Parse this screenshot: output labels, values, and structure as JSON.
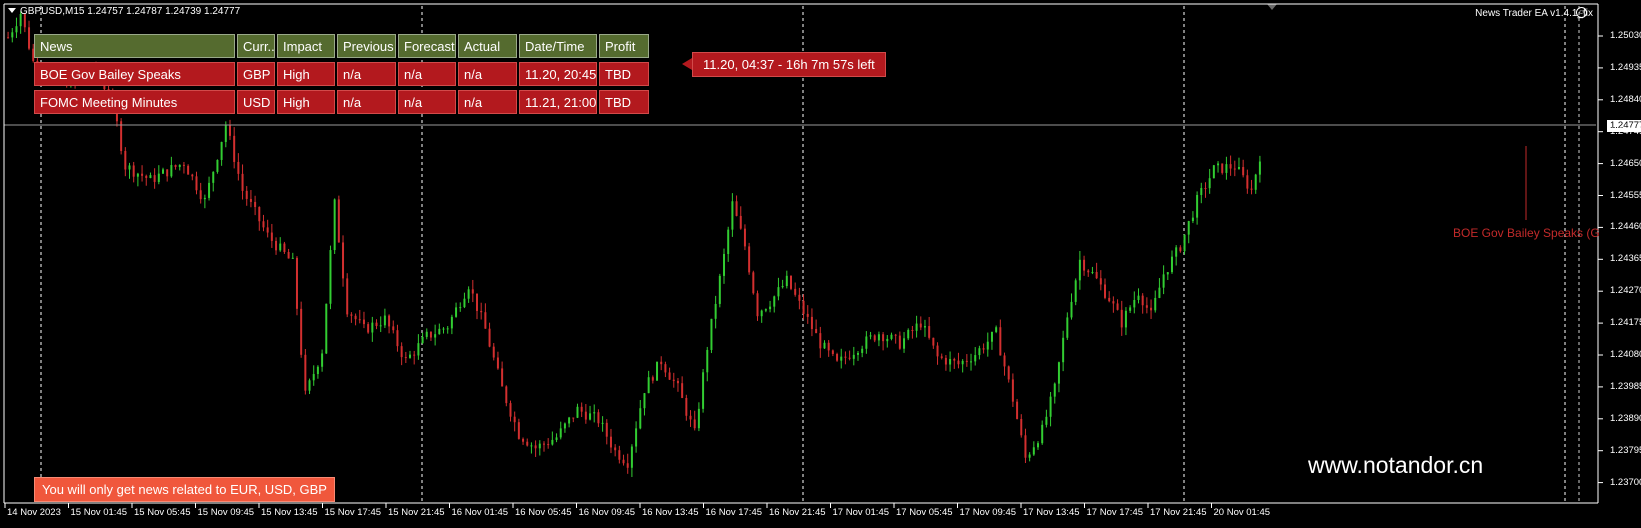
{
  "header": {
    "symbol_info": "GBPUSD,M15  1.24757 1.24787 1.24739 1.24777",
    "ea_name": "News Trader EA  v1.4.1_fix",
    "smile_icon": "smiley-icon"
  },
  "news_table": {
    "columns": [
      "News",
      "Curr..",
      "Impact",
      "Previous",
      "Forecast",
      "Actual",
      "Date/Time",
      "Profit"
    ],
    "rows": [
      [
        "BOE Gov Bailey Speaks",
        "GBP",
        "High",
        "n/a",
        "n/a",
        "n/a",
        "11.20, 20:45",
        "TBD"
      ],
      [
        "FOMC Meeting Minutes",
        "USD",
        "High",
        "n/a",
        "n/a",
        "n/a",
        "11.21, 21:00",
        "TBD"
      ]
    ]
  },
  "countdown": "11.20, 04:37 - 16h 7m 57s left",
  "filter_note": "You will only get news related to EUR, USD, GBP",
  "watermark": "www.notandor.cn",
  "event_marker_label": "BOE Gov Bailey Speaks (G",
  "price_axis": {
    "labels": [
      "1.25030",
      "1.24935",
      "1.24840",
      "1.24745",
      "1.24650",
      "1.24555",
      "1.24460",
      "1.24365",
      "1.24270",
      "1.24175",
      "1.24080",
      "1.23985",
      "1.23890",
      "1.23795",
      "1.23700"
    ],
    "current_price": "1.24777"
  },
  "time_axis": {
    "labels": [
      "14 Nov 2023",
      "15 Nov 01:45",
      "15 Nov 05:45",
      "15 Nov 09:45",
      "15 Nov 13:45",
      "15 Nov 17:45",
      "15 Nov 21:45",
      "16 Nov 01:45",
      "16 Nov 05:45",
      "16 Nov 09:45",
      "16 Nov 13:45",
      "16 Nov 17:45",
      "16 Nov 21:45",
      "17 Nov 01:45",
      "17 Nov 05:45",
      "17 Nov 09:45",
      "17 Nov 13:45",
      "17 Nov 17:45",
      "17 Nov 21:45",
      "20 Nov 01:45"
    ]
  },
  "colors": {
    "bull": "#32cd32",
    "bear": "#d32f2f",
    "grid_day": "#ffffff",
    "header_bg": "#556b2f",
    "row_bg": "#b3191e",
    "note_bg": "#f0573c"
  },
  "chart_data": {
    "type": "candlestick",
    "title": "GBPUSD,M15",
    "ylim": [
      1.2366,
      1.2508
    ],
    "close_path": [
      [
        0,
        1.2499
      ],
      [
        3,
        1.2506
      ],
      [
        6,
        1.2492
      ],
      [
        10,
        1.2488
      ],
      [
        16,
        1.2486
      ],
      [
        21,
        1.249
      ],
      [
        25,
        1.248
      ],
      [
        28,
        1.2462
      ],
      [
        34,
        1.2458
      ],
      [
        42,
        1.2463
      ],
      [
        47,
        1.2452
      ],
      [
        52,
        1.2474
      ],
      [
        56,
        1.2455
      ],
      [
        62,
        1.2442
      ],
      [
        68,
        1.2434
      ],
      [
        71,
        1.2396
      ],
      [
        75,
        1.2409
      ],
      [
        78,
        1.2451
      ],
      [
        81,
        1.2421
      ],
      [
        85,
        1.2415
      ],
      [
        90,
        1.2418
      ],
      [
        95,
        1.2406
      ],
      [
        100,
        1.2413
      ],
      [
        105,
        1.2416
      ],
      [
        110,
        1.2428
      ],
      [
        114,
        1.2415
      ],
      [
        118,
        1.2398
      ],
      [
        122,
        1.2385
      ],
      [
        126,
        1.2381
      ],
      [
        131,
        1.2384
      ],
      [
        136,
        1.2392
      ],
      [
        141,
        1.2389
      ],
      [
        145,
        1.238
      ],
      [
        148,
        1.2377
      ],
      [
        152,
        1.2398
      ],
      [
        156,
        1.2406
      ],
      [
        160,
        1.2398
      ],
      [
        164,
        1.2385
      ],
      [
        167,
        1.241
      ],
      [
        171,
        1.2436
      ],
      [
        173,
        1.2451
      ],
      [
        176,
        1.2439
      ],
      [
        179,
        1.242
      ],
      [
        182,
        1.2423
      ],
      [
        186,
        1.2429
      ],
      [
        190,
        1.242
      ],
      [
        194,
        1.2411
      ],
      [
        198,
        1.2405
      ],
      [
        203,
        1.241
      ],
      [
        208,
        1.2414
      ],
      [
        213,
        1.2411
      ],
      [
        218,
        1.2417
      ],
      [
        222,
        1.2407
      ],
      [
        227,
        1.2405
      ],
      [
        231,
        1.2408
      ],
      [
        236,
        1.2414
      ],
      [
        240,
        1.2395
      ],
      [
        243,
        1.2378
      ],
      [
        247,
        1.2386
      ],
      [
        250,
        1.2398
      ],
      [
        253,
        1.2419
      ],
      [
        256,
        1.2435
      ],
      [
        259,
        1.2431
      ],
      [
        263,
        1.2424
      ],
      [
        266,
        1.2417
      ],
      [
        270,
        1.2426
      ],
      [
        273,
        1.2419
      ],
      [
        276,
        1.2431
      ],
      [
        280,
        1.2439
      ],
      [
        284,
        1.2452
      ],
      [
        288,
        1.2461
      ],
      [
        293,
        1.2462
      ],
      [
        297,
        1.2455
      ],
      [
        299,
        1.2465
      ]
    ]
  }
}
